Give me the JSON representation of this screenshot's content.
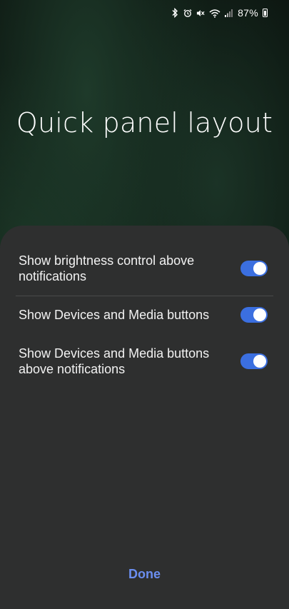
{
  "status_bar": {
    "battery_percent": "87%",
    "icons": [
      "bluetooth-icon",
      "alarm-icon",
      "mute-icon",
      "wifi-icon",
      "signal-icon",
      "battery-icon"
    ]
  },
  "title": "Quick panel layout",
  "settings": [
    {
      "label": "Show brightness control above notifications",
      "enabled": true
    },
    {
      "label": "Show Devices and Media buttons",
      "enabled": true
    },
    {
      "label": "Show Devices and Media buttons above notifications",
      "enabled": true
    }
  ],
  "done_label": "Done",
  "colors": {
    "toggle_on": "#3b6fe0",
    "accent_text": "#6b8ef0",
    "panel_bg": "#2e2f2f"
  }
}
